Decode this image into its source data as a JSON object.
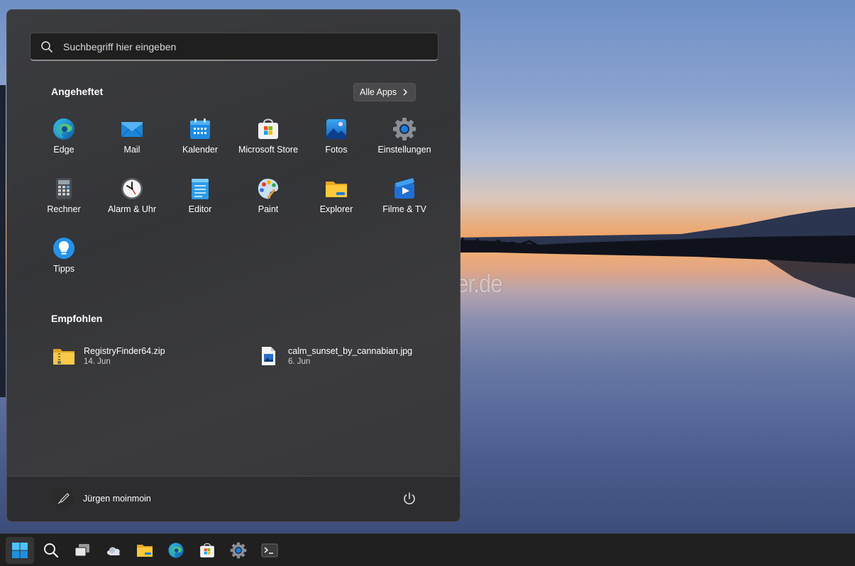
{
  "search": {
    "placeholder": "Suchbegriff hier eingeben",
    "icon": "search-icon"
  },
  "pinned": {
    "title": "Angeheftet",
    "all_apps_label": "Alle Apps",
    "apps": [
      {
        "label": "Edge",
        "icon": "edge-icon"
      },
      {
        "label": "Mail",
        "icon": "mail-icon"
      },
      {
        "label": "Kalender",
        "icon": "calendar-icon"
      },
      {
        "label": "Microsoft Store",
        "icon": "store-icon"
      },
      {
        "label": "Fotos",
        "icon": "photos-icon"
      },
      {
        "label": "Einstellungen",
        "icon": "gear-icon"
      },
      {
        "label": "Rechner",
        "icon": "calculator-icon"
      },
      {
        "label": "Alarm & Uhr",
        "icon": "clock-icon"
      },
      {
        "label": "Editor",
        "icon": "notepad-icon"
      },
      {
        "label": "Paint",
        "icon": "paint-icon"
      },
      {
        "label": "Explorer",
        "icon": "folder-icon"
      },
      {
        "label": "Filme & TV",
        "icon": "film-icon"
      },
      {
        "label": "Tipps",
        "icon": "lightbulb-icon"
      }
    ]
  },
  "recommended": {
    "title": "Empfohlen",
    "items": [
      {
        "name": "RegistryFinder64.zip",
        "date": "14. Jun",
        "icon": "zip-folder-icon"
      },
      {
        "name": "calm_sunset_by_cannabian.jpg",
        "date": "6. Jun",
        "icon": "image-file-icon"
      }
    ]
  },
  "user": {
    "name": "Jürgen moinmoin",
    "icon": "user-avatar-icon"
  },
  "watermark": "Deskmodder.de",
  "taskbar": {
    "items": [
      "start-icon",
      "search-icon",
      "task-view-icon",
      "widgets-icon",
      "folder-icon",
      "edge-icon",
      "store-icon",
      "gear-icon",
      "terminal-icon"
    ]
  },
  "colors": {
    "accent": "#0a84d6",
    "menu_bg": "#38393b",
    "taskbar_bg": "#202020"
  }
}
